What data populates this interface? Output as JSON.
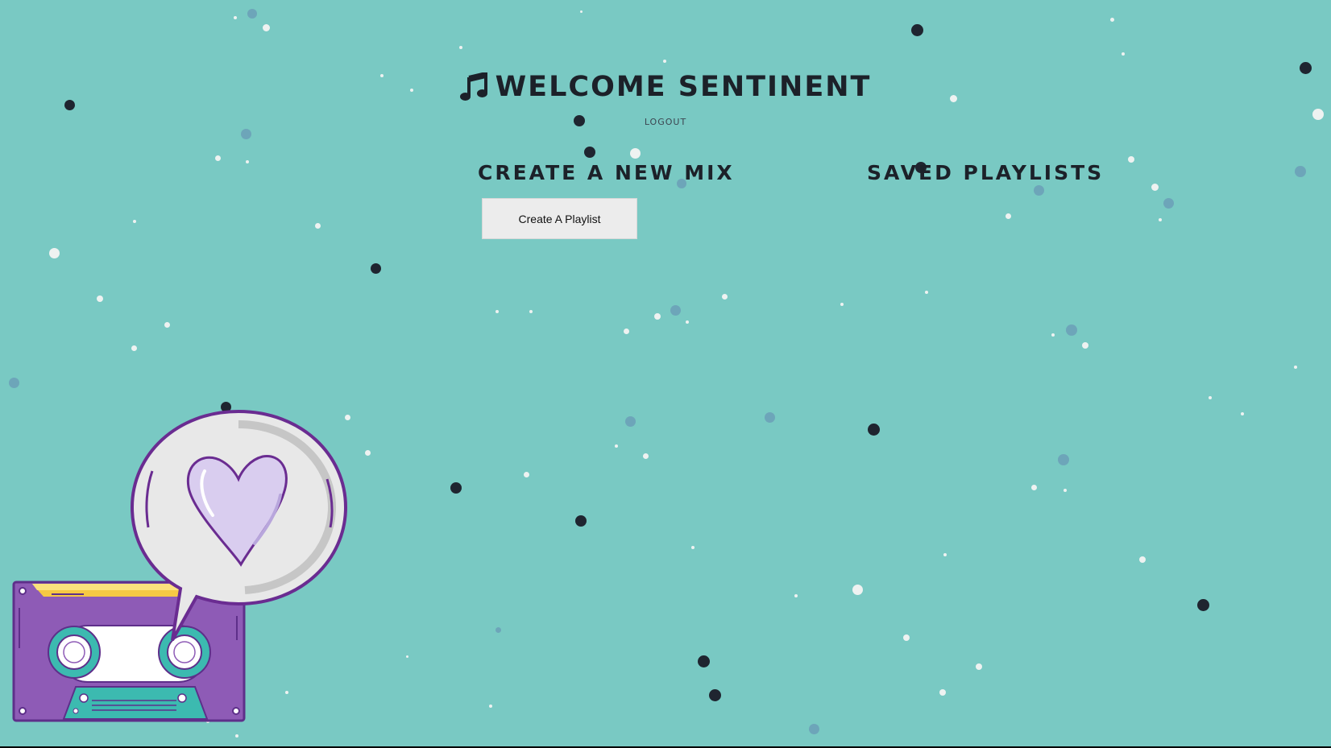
{
  "header": {
    "title": "WELCOME SENTINENT",
    "icon": "music-note-icon",
    "logout_label": "LOGOUT"
  },
  "create_section": {
    "heading": "CREATE A NEW MIX",
    "button_label": "Create A Playlist"
  },
  "saved_section": {
    "heading": "SAVED PLAYLISTS"
  },
  "illustration": {
    "name": "cassette-love-illustration"
  },
  "colors": {
    "background": "#79c9c3",
    "text": "#1c2129",
    "button_bg": "#ececec",
    "cassette": "#8e5bb6",
    "heart": "#d9cdef"
  }
}
